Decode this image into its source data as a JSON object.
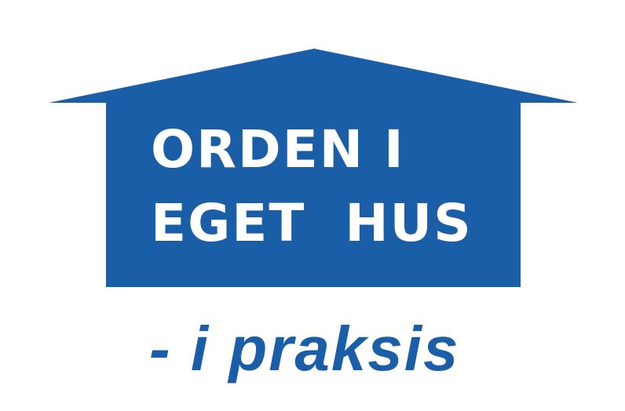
{
  "logo": {
    "line1": "ORDEN I",
    "line2": "EGET  HUS",
    "tagline": "- i praksis",
    "colors": {
      "house_fill": "#1a5ea8",
      "house_text": "#ffffff",
      "tagline_text": "#1a5ea8",
      "background": "#ffffff"
    },
    "icons": {
      "house": "house-icon"
    }
  }
}
